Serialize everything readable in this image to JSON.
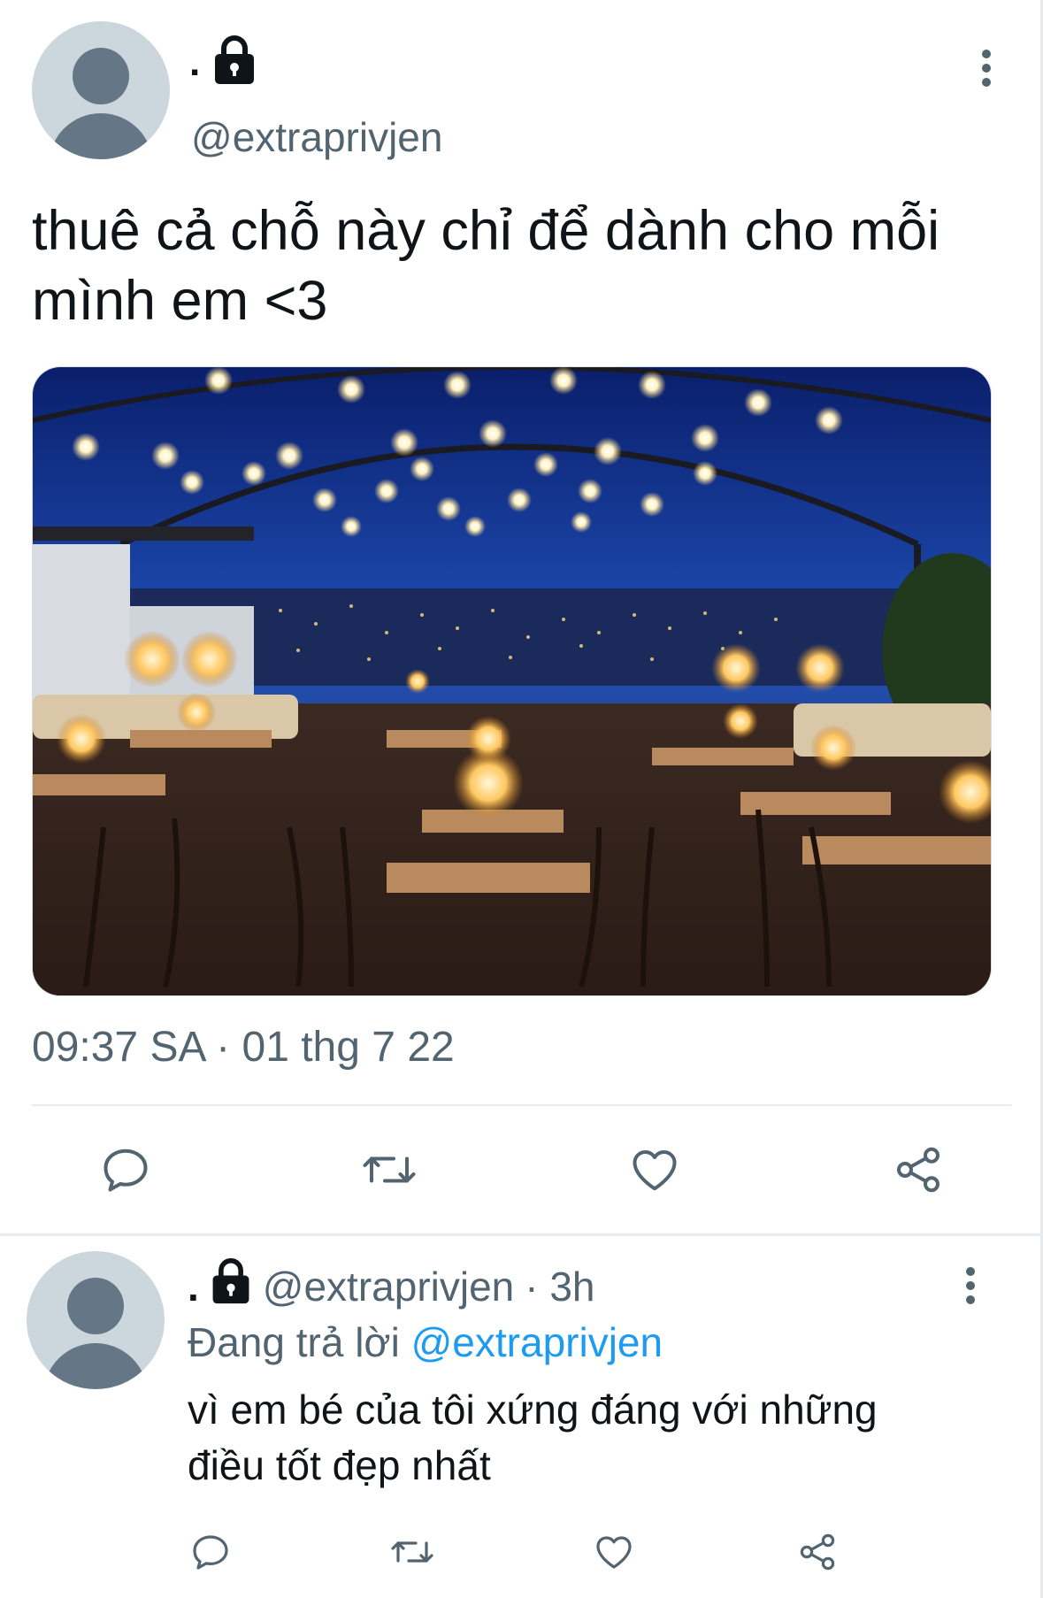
{
  "tweet": {
    "author_name": ".",
    "author_handle": "@extraprivjen",
    "text_line1": "thuê cả chỗ này chỉ để dành cho mỗi",
    "text_line2": "mình em <3",
    "media_description_icon": "photo",
    "timestamp": "09:37 SA · 01 thg 7 22"
  },
  "actions": {
    "reply": "reply-icon",
    "retweet": "retweet-icon",
    "like": "heart-icon",
    "share": "share-icon"
  },
  "reply": {
    "author_name": ".",
    "author_handle": "@extraprivjen",
    "time": "· 3h",
    "replying_prefix": "Đang trả lời",
    "replying_to": "@extraprivjen",
    "text_line1": "vì em bé của tôi xứng đáng với những",
    "text_line2": "điều tốt đẹp nhất"
  },
  "colors": {
    "text": "#0f1419",
    "secondary": "#536471",
    "link": "#1d9bf0",
    "avatar_bg": "#ccd6dd",
    "avatar_fg": "#657786",
    "divider": "#e6ecf0"
  }
}
